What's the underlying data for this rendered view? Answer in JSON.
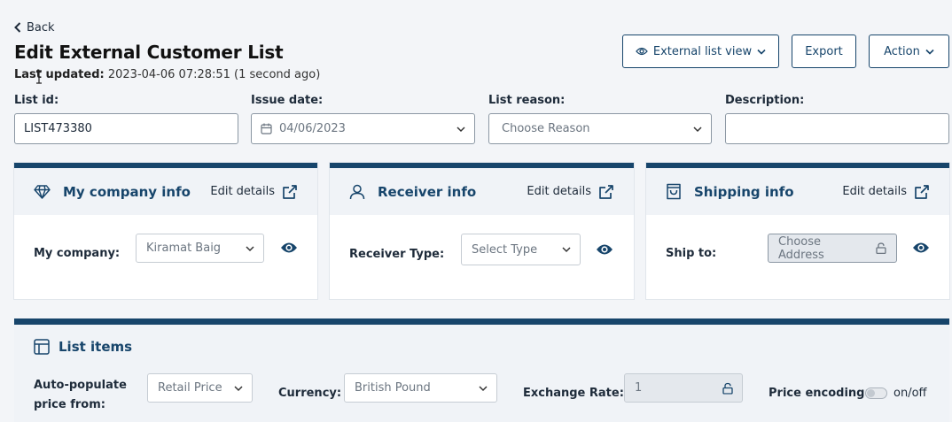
{
  "header": {
    "back_label": "Back",
    "title": "Edit External Customer List",
    "last_updated_label": "Last updated:",
    "last_updated_value": "2023-04-06 07:28:51 (1 second ago)"
  },
  "toolbar": {
    "external_view_label": "External list view",
    "export_label": "Export",
    "action_label": "Action"
  },
  "form": {
    "list_id_label": "List id:",
    "list_id_value": "LIST473380",
    "issue_date_label": "Issue date:",
    "issue_date_value": "04/06/2023",
    "list_reason_label": "List reason:",
    "list_reason_value": "Choose Reason",
    "description_label": "Description:",
    "description_value": ""
  },
  "cards": {
    "company": {
      "title": "My company info",
      "edit_label": "Edit details",
      "field_label": "My company:",
      "field_value": "Kiramat Baig"
    },
    "receiver": {
      "title": "Receiver info",
      "edit_label": "Edit details",
      "field_label": "Receiver Type:",
      "field_value": "Select Type"
    },
    "shipping": {
      "title": "Shipping info",
      "edit_label": "Edit details",
      "field_label": "Ship to:",
      "field_value": "Choose Address"
    }
  },
  "list_items": {
    "title": "List items",
    "auto_populate_label_1": "Auto-populate",
    "auto_populate_label_2": "price from:",
    "auto_populate_value": "Retail Price",
    "currency_label": "Currency:",
    "currency_value": "British Pound",
    "exchange_rate_label": "Exchange Rate:",
    "exchange_rate_value": "1",
    "price_encoding_label": "Price encoding:",
    "price_encoding_toggle_label": "on/off"
  },
  "colors": {
    "accent": "#17456b",
    "page_bg": "#f3f5f8",
    "panel_header_bg": "#f0f3f7"
  },
  "icons": {
    "back": "chevron-left-icon",
    "external_view": "eye-icon",
    "dropdown": "chevron-down-icon",
    "calendar": "calendar-icon",
    "company": "diamond-icon",
    "receiver": "user-icon",
    "shipping": "shopping-bag-icon",
    "edit_details": "external-link-icon",
    "lock": "lock-icon",
    "list_items": "table-icon"
  }
}
